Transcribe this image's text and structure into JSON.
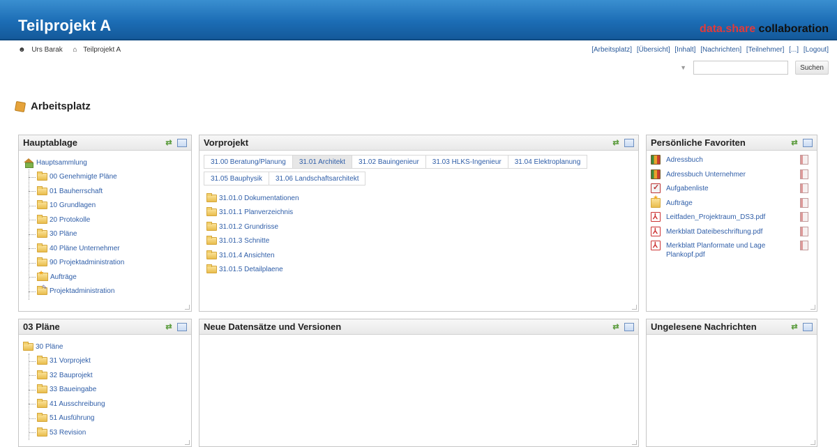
{
  "header": {
    "title": "Teilprojekt A",
    "brand_part1": "data.share",
    "brand_part2": "collaboration"
  },
  "userbar": {
    "user": "Urs Barak",
    "project": "Teilprojekt A"
  },
  "nav": [
    "[Arbeitsplatz]",
    "[Übersicht]",
    "[Inhalt]",
    "[Nachrichten]",
    "[Teilnehmer]",
    "[...]",
    "[Logout]"
  ],
  "search": {
    "placeholder": "",
    "button": "Suchen"
  },
  "page_title": "Arbeitsplatz",
  "panels": {
    "hauptablage": {
      "title": "Hauptablage",
      "root": "Hauptsammlung",
      "items": [
        "00 Genehmigte Pläne",
        "01 Bauherrschaft",
        "10 Grundlagen",
        "20 Protokolle",
        "30 Pläne",
        "40 Pläne Unternehmer",
        "90 Projektadministration",
        "Aufträge",
        "Projektadministration"
      ]
    },
    "vorprojekt": {
      "title": "Vorprojekt",
      "tabs": [
        "31.00 Beratung/Planung",
        "31.01 Architekt",
        "31.02 Bauingenieur",
        "31.03 HLKS-Ingenieur",
        "31.04 Elektroplanung",
        "31.05 Bauphysik",
        "31.06 Landschaftsarchitekt"
      ],
      "active_tab": "31.01 Architekt",
      "items": [
        "31.01.0 Dokumentationen",
        "31.01.1 Planverzeichnis",
        "31.01.2 Grundrisse",
        "31.01.3 Schnitte",
        "31.01.4 Ansichten",
        "31.01.5 Detailplaene"
      ]
    },
    "favoriten": {
      "title": "Persönliche Favoriten",
      "items": [
        {
          "label": "Adressbuch",
          "icon": "address-book-icon"
        },
        {
          "label": "Adressbuch Unternehmer",
          "icon": "address-book-icon"
        },
        {
          "label": "Aufgabenliste",
          "icon": "task-list-icon"
        },
        {
          "label": "Aufträge",
          "icon": "star-folder-icon"
        },
        {
          "label": "Leitfaden_Projektraum_DS3.pdf",
          "icon": "pdf-icon"
        },
        {
          "label": "Merkblatt Dateibeschriftung.pdf",
          "icon": "pdf-icon"
        },
        {
          "label": "Merkblatt Planformate und Lage Plankopf.pdf",
          "icon": "pdf-icon"
        }
      ]
    },
    "plaene": {
      "title": "03 Pläne",
      "root": "30 Pläne",
      "items": [
        "31 Vorprojekt",
        "32 Bauprojekt",
        "33 Baueingabe",
        "41 Ausschreibung",
        "51 Ausführung",
        "53 Revision"
      ]
    },
    "neue": {
      "title": "Neue Datensätze und Versionen"
    },
    "nachrichten": {
      "title": "Ungelesene Nachrichten"
    }
  },
  "colors": {
    "header_blue": "#1c6db5",
    "link_blue": "#2f5ea8",
    "brand_red": "#e23a3a"
  }
}
